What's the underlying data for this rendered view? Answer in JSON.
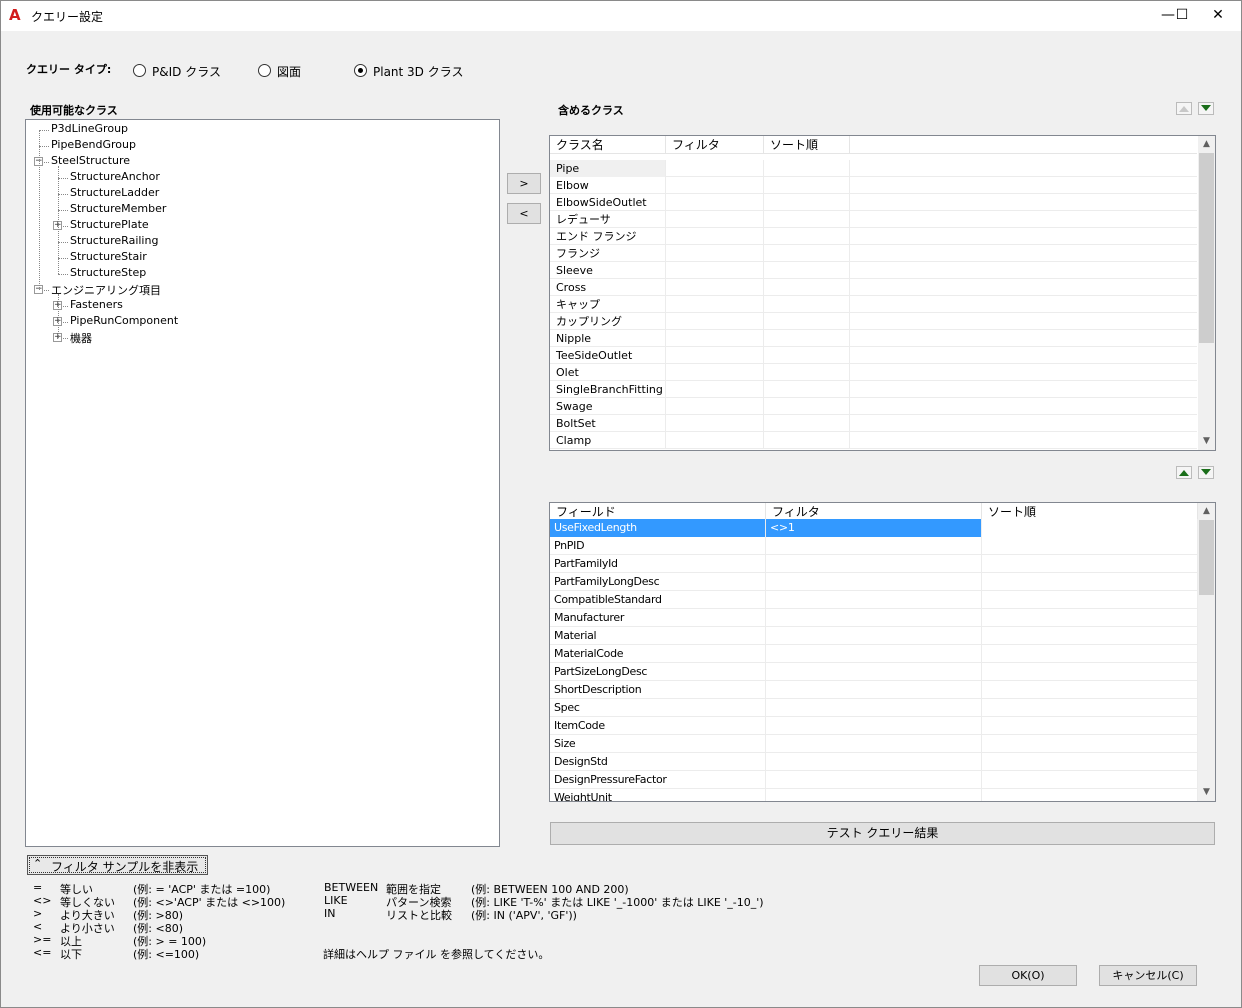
{
  "window": {
    "title": "クエリー設定",
    "app_icon": "A"
  },
  "titlebar_buttons": {
    "minimize": "—",
    "maximize": "☐",
    "close": "✕"
  },
  "query_type": {
    "label": "クエリー タイプ:",
    "options": [
      {
        "label": "P&ID クラス",
        "selected": false
      },
      {
        "label": "図面",
        "selected": false
      },
      {
        "label": "Plant 3D クラス",
        "selected": true
      }
    ]
  },
  "available": {
    "title": "使用可能なクラス",
    "tree": [
      {
        "label": "P3dLineGroup",
        "level": 0,
        "expander": ""
      },
      {
        "label": "PipeBendGroup",
        "level": 0,
        "expander": ""
      },
      {
        "label": "SteelStructure",
        "level": 0,
        "expander": "−"
      },
      {
        "label": "StructureAnchor",
        "level": 1,
        "expander": ""
      },
      {
        "label": "StructureLadder",
        "level": 1,
        "expander": ""
      },
      {
        "label": "StructureMember",
        "level": 1,
        "expander": ""
      },
      {
        "label": "StructurePlate",
        "level": 1,
        "expander": "+"
      },
      {
        "label": "StructureRailing",
        "level": 1,
        "expander": ""
      },
      {
        "label": "StructureStair",
        "level": 1,
        "expander": ""
      },
      {
        "label": "StructureStep",
        "level": 1,
        "expander": ""
      },
      {
        "label": "エンジニアリング項目",
        "level": 0,
        "expander": "−"
      },
      {
        "label": "Fasteners",
        "level": 1,
        "expander": "+"
      },
      {
        "label": "PipeRunComponent",
        "level": 1,
        "expander": "+"
      },
      {
        "label": "機器",
        "level": 1,
        "expander": "+"
      }
    ]
  },
  "move_buttons": {
    "add": ">",
    "remove": "<"
  },
  "included": {
    "title": "含めるクラス",
    "columns": [
      "クラス名",
      "フィルタ",
      "ソート順"
    ],
    "rows": [
      "Pipe",
      "Elbow",
      "ElbowSideOutlet",
      "レデューサ",
      "エンド フランジ",
      "フランジ",
      "Sleeve",
      "Cross",
      "キャップ",
      "カップリング",
      "Nipple",
      "TeeSideOutlet",
      "Olet",
      "SingleBranchFitting",
      "Swage",
      "BoltSet",
      "Clamp"
    ]
  },
  "fields": {
    "columns": [
      "フィールド",
      "フィルタ",
      "ソート順"
    ],
    "rows": [
      {
        "field": "UseFixedLength",
        "filter": "<>1",
        "sort": "",
        "selected": true
      },
      {
        "field": "PnPID",
        "filter": "",
        "sort": ""
      },
      {
        "field": "PartFamilyId",
        "filter": "",
        "sort": ""
      },
      {
        "field": "PartFamilyLongDesc",
        "filter": "",
        "sort": ""
      },
      {
        "field": "CompatibleStandard",
        "filter": "",
        "sort": ""
      },
      {
        "field": "Manufacturer",
        "filter": "",
        "sort": ""
      },
      {
        "field": "Material",
        "filter": "",
        "sort": ""
      },
      {
        "field": "MaterialCode",
        "filter": "",
        "sort": ""
      },
      {
        "field": "PartSizeLongDesc",
        "filter": "",
        "sort": ""
      },
      {
        "field": "ShortDescription",
        "filter": "",
        "sort": ""
      },
      {
        "field": "Spec",
        "filter": "",
        "sort": ""
      },
      {
        "field": "ItemCode",
        "filter": "",
        "sort": ""
      },
      {
        "field": "Size",
        "filter": "",
        "sort": ""
      },
      {
        "field": "DesignStd",
        "filter": "",
        "sort": ""
      },
      {
        "field": "DesignPressureFactor",
        "filter": "",
        "sort": ""
      },
      {
        "field": "WeightUnit",
        "filter": "",
        "sort": ""
      }
    ]
  },
  "test_button": "テスト クエリー結果",
  "hide_samples_button": "フィルタ サンプルを非表示",
  "samples_left": [
    {
      "op": "=",
      "desc": "等しい",
      "ex": "(例: = 'ACP' または =100)"
    },
    {
      "op": "<>",
      "desc": "等しくない",
      "ex": "(例: <>'ACP' または <>100)"
    },
    {
      "op": ">",
      "desc": "より大きい",
      "ex": "(例: >80)"
    },
    {
      "op": "<",
      "desc": "より小さい",
      "ex": "(例: <80)"
    },
    {
      "op": ">=",
      "desc": "以上",
      "ex": "(例: > = 100)"
    },
    {
      "op": "<=",
      "desc": "以下",
      "ex": "(例: <=100)"
    }
  ],
  "samples_right": [
    {
      "op": "BETWEEN",
      "desc": "範囲を指定",
      "ex": "(例: BETWEEN 100 AND 200)"
    },
    {
      "op": "LIKE",
      "desc": "パターン検索",
      "ex": "(例: LIKE 'T-%' または LIKE '_-1000' または LIKE '_-10_')"
    },
    {
      "op": "IN",
      "desc": "リストと比較",
      "ex": "(例: IN ('APV', 'GF'))"
    }
  ],
  "help_note": "詳細はヘルプ ファイル を参照してください。",
  "ok_button": "OK(O)",
  "cancel_button": "キャンセル(C)",
  "colors": {
    "selection": "#3399ff",
    "accent_green": "#1a6e1a"
  }
}
